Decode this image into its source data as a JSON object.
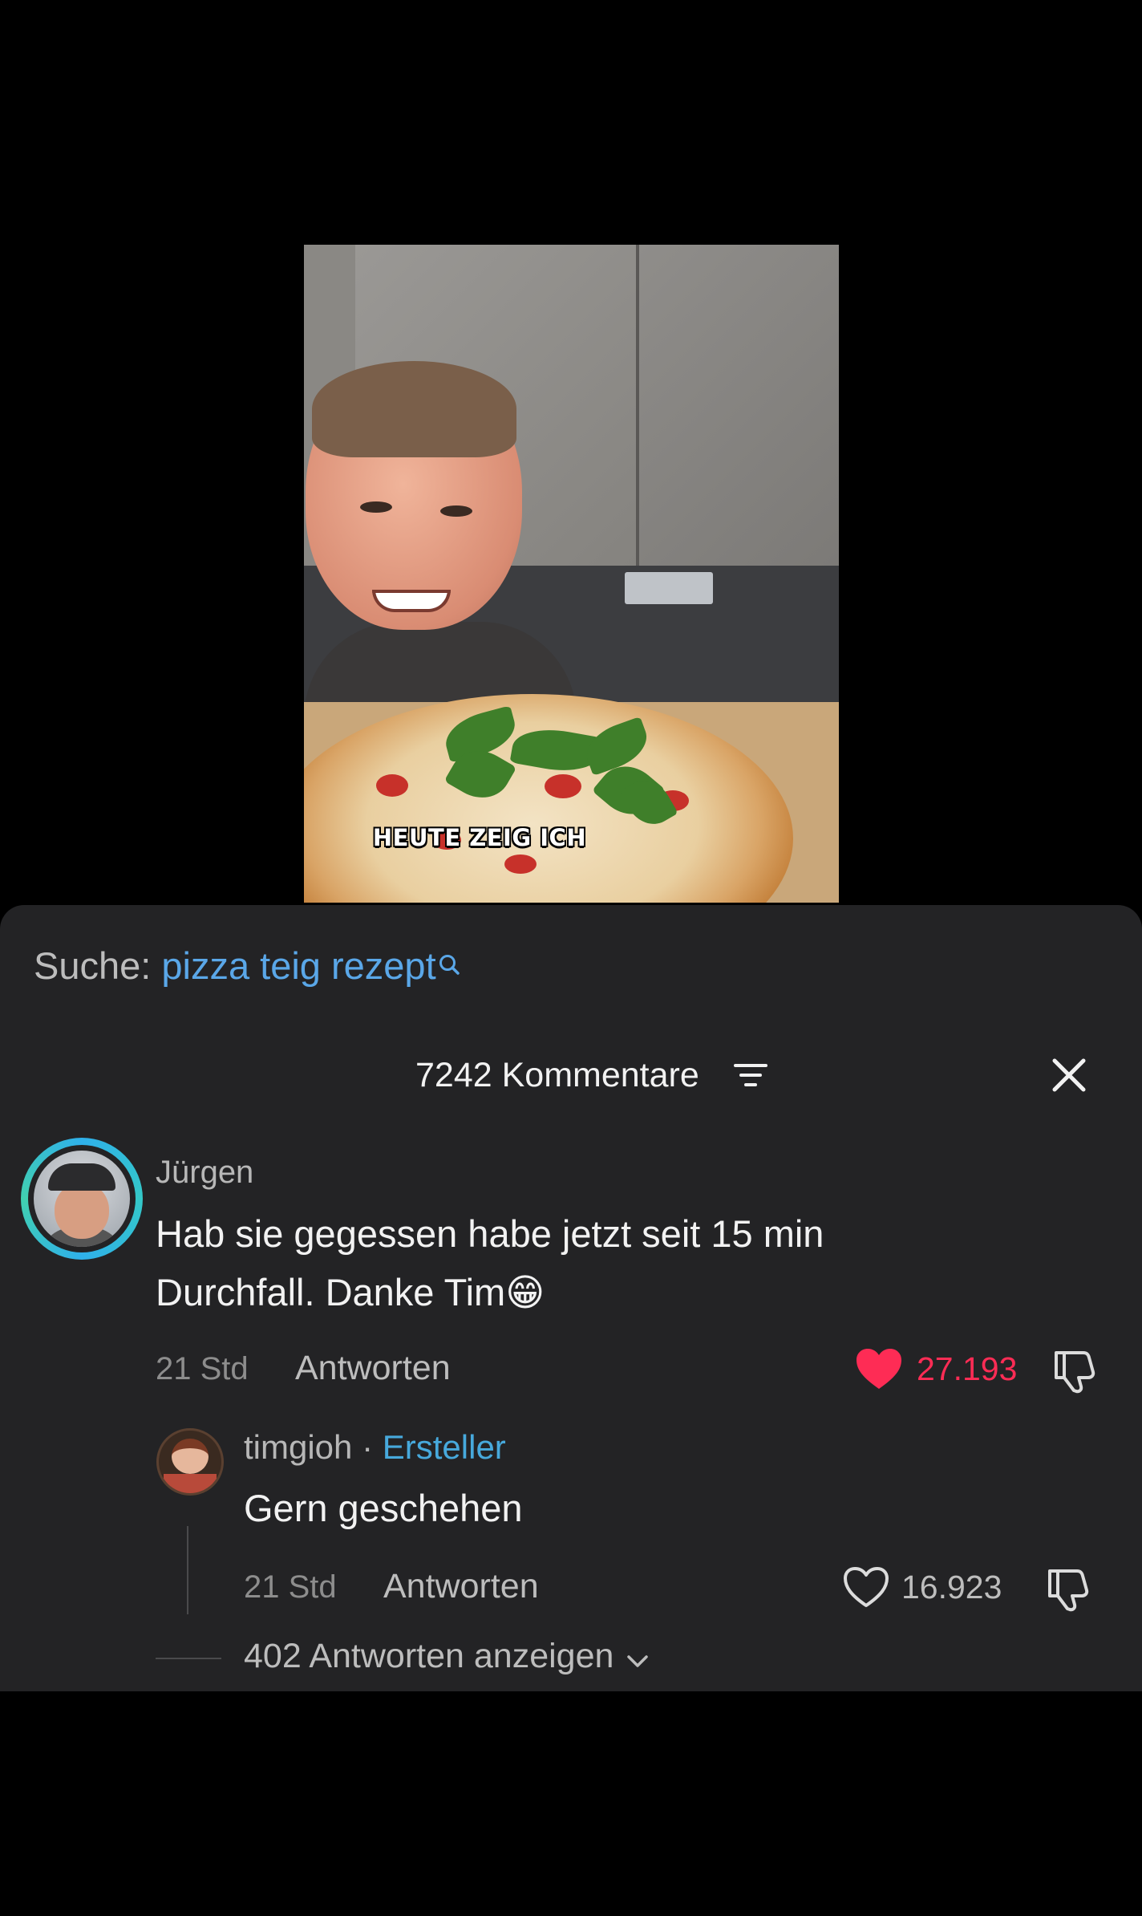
{
  "video": {
    "caption": "HEUTE ZEIG ICH"
  },
  "search": {
    "label": "Suche:",
    "query": "pizza teig rezept",
    "icon": "search-icon"
  },
  "comments_header": {
    "title": "7242 Kommentare",
    "filter_icon": "filter-icon",
    "close_icon": "close-icon"
  },
  "comment": {
    "username": "Jürgen",
    "text": "Hab sie gegessen habe jetzt seit 15 min Durchfall. Danke Tim",
    "emoji": "😁",
    "time": "21 Std",
    "reply_label": "Antworten",
    "likes": "27.193",
    "liked": true,
    "like_color": "#fe2c55"
  },
  "reply": {
    "username": "timgioh",
    "separator": "·",
    "badge": "Ersteller",
    "text": "Gern geschehen",
    "time": "21 Std",
    "reply_label": "Antworten",
    "likes": "16.923",
    "liked": false
  },
  "view_replies": {
    "label": "402 Antworten anzeigen"
  },
  "colors": {
    "sheet_bg": "#232325",
    "accent_blue": "#5aa7e8",
    "creator_blue": "#47a9dc",
    "like_red": "#fe2c55"
  }
}
